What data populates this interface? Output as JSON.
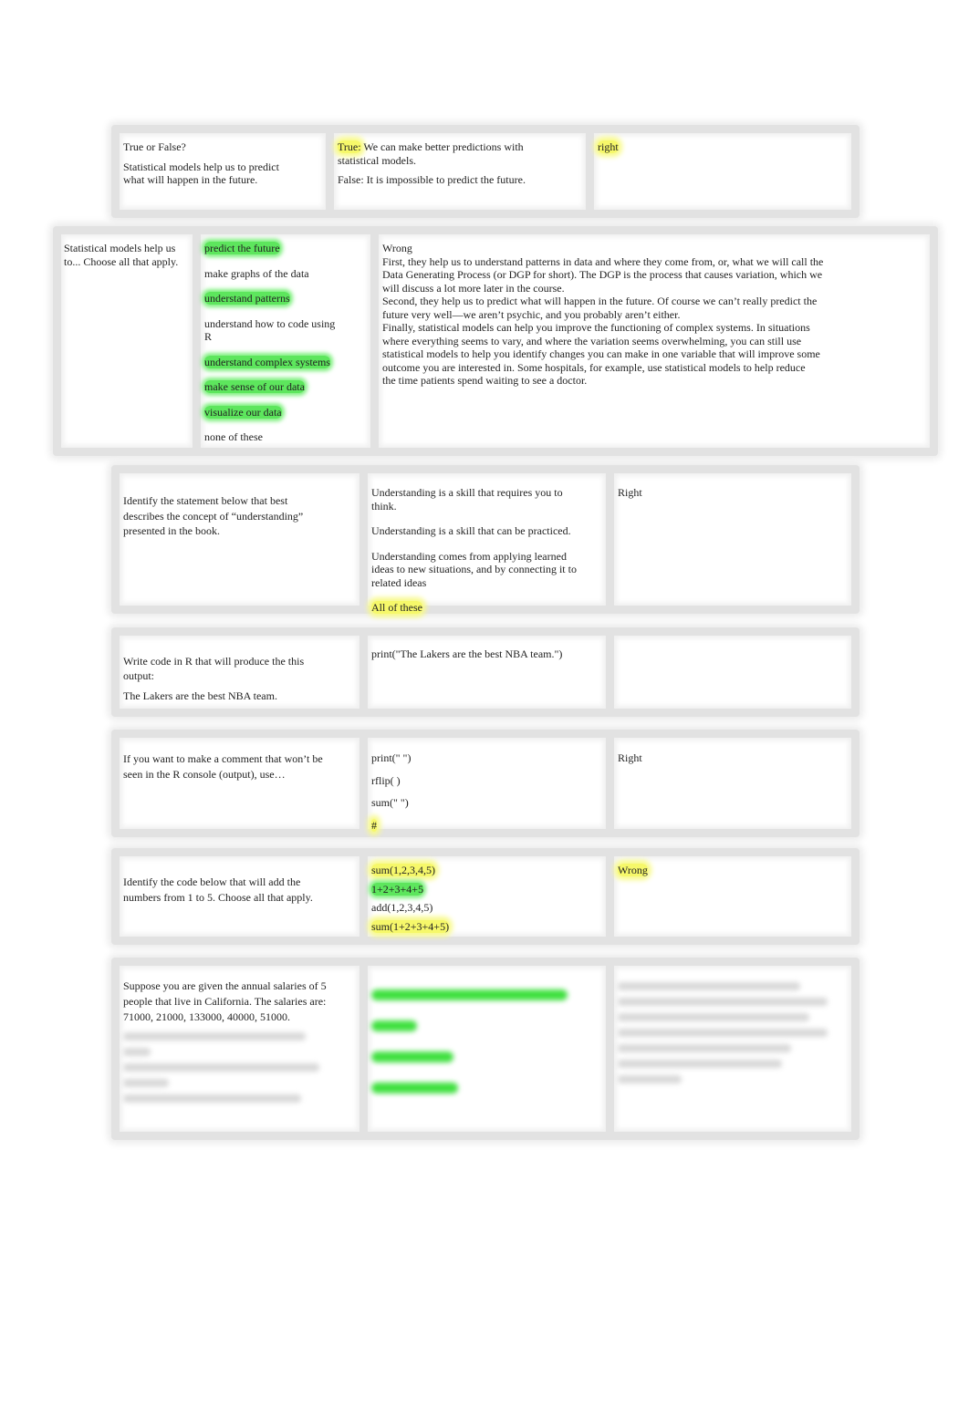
{
  "q1": {
    "question_lines": [
      "True or False?",
      "Statistical models help us to predict what will happen in the future."
    ],
    "answer_true_label": "True:",
    "answer_true_text": " We can make better predictions with statistical models.",
    "answer_false": "False: It is impossible to predict the future.",
    "result": "right"
  },
  "q2": {
    "question": "Statistical models help us to... Choose all that apply.",
    "options": [
      {
        "text": "predict the future",
        "selected": true
      },
      {
        "text": "make graphs of the data",
        "selected": false
      },
      {
        "text": "understand patterns",
        "selected": true
      },
      {
        "text": "understand how to code using R",
        "selected": false
      },
      {
        "text": "understand complex systems",
        "selected": true
      },
      {
        "text": "make sense of our data",
        "selected": true
      },
      {
        "text": "visualize our data",
        "selected": true
      },
      {
        "text": "none of these",
        "selected": false
      }
    ],
    "result": "Wrong",
    "feedback": [
      "First, they help us to understand patterns in data and where they come from, or, what we will call the   Data Generating Process            (or DGP for short). The DGP is the process that causes variation, which we will discuss a lot more later in the course.",
      "Second, they help us to predict what will happen in the future. Of course we can’t really predict the future very well—we aren’t psychic, and you probably aren’t either.",
      "Finally, statistical models can help you improve the functioning of complex systems. In situations where everything seems to vary, and where the variation seems overwhelming, you can still use statistical models to help you identify changes you can make in one variable that will improve some outcome you are interested in. Some hospitals, for example, use statistical models to help reduce the time patients spend waiting to see a doctor."
    ]
  },
  "q3": {
    "question": "Identify the statement below that best describes the concept of “understanding” presented in the book.",
    "options": [
      {
        "text": "Understanding is a skill that requires you to think.",
        "selected": false
      },
      {
        "text": "Understanding is a skill that can be practiced.",
        "selected": false
      },
      {
        "text": "Understanding comes from applying learned ideas to new situations, and by connecting it to related ideas",
        "selected": false
      },
      {
        "text": "All of these",
        "selected": true
      }
    ],
    "result": "Right"
  },
  "q4": {
    "question": "Write code in R that will produce the this output:",
    "output": "The Lakers are the best NBA team.",
    "answer": "print(\"The Lakers are the best NBA team.\")",
    "result": ""
  },
  "q5": {
    "question": "If you want to make a comment that won’t be seen in the R console (output), use…",
    "options": [
      {
        "text": "print(\" \")",
        "selected": false
      },
      {
        "text": "rflip( )",
        "selected": false
      },
      {
        "text": "sum(\" \")",
        "selected": false
      },
      {
        "text": "#",
        "selected": true
      }
    ],
    "result": "Right"
  },
  "q6": {
    "question": "Identify the code below that will add the numbers from 1 to 5. Choose all that apply.",
    "options": [
      {
        "text": "sum(1,2,3,4,5)",
        "hl": "yellow"
      },
      {
        "text": "1+2+3+4+5",
        "hl": "green"
      },
      {
        "text": "add(1,2,3,4,5)",
        "hl": ""
      },
      {
        "text": "sum(1+2+3+4+5)",
        "hl": "yellow"
      }
    ],
    "result": "Wrong"
  },
  "q7": {
    "question": "Suppose you are given the annual salaries of 5 people that live in California. The salaries are: 71000, 21000, 133000, 40000, 51000."
  },
  "colors": {
    "highlight_yellow": "#f6f86a",
    "highlight_green": "#5de65d"
  }
}
